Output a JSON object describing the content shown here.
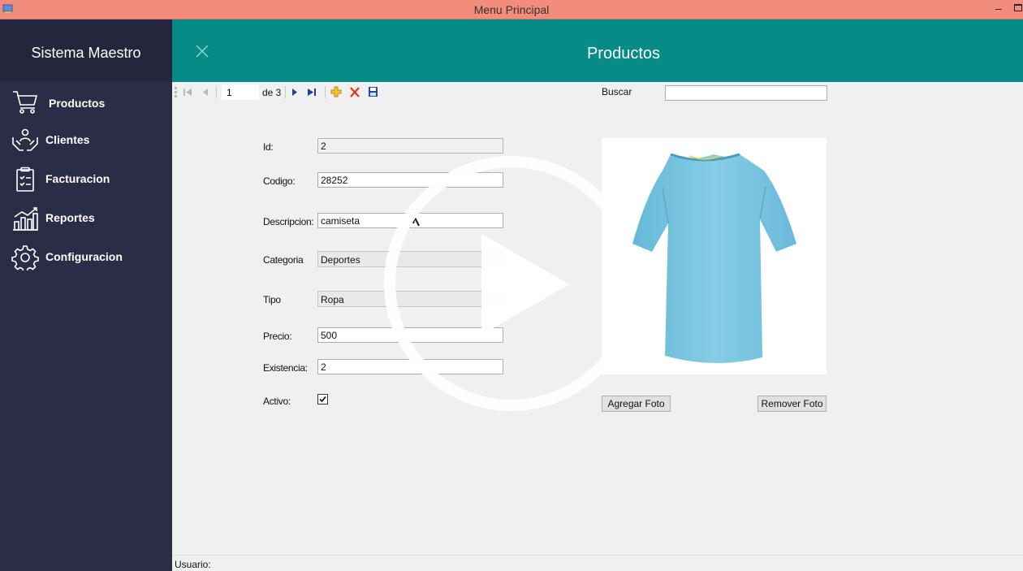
{
  "window": {
    "title": "Menu Principal",
    "minimize_glyph": "–"
  },
  "sidebar": {
    "title": "Sistema Maestro",
    "items": [
      {
        "label": "Productos",
        "icon": "cart-icon"
      },
      {
        "label": "Clientes",
        "icon": "hands-people-icon"
      },
      {
        "label": "Facturacion",
        "icon": "clipboard-check-icon"
      },
      {
        "label": "Reportes",
        "icon": "bar-chart-icon"
      },
      {
        "label": "Configuracion",
        "icon": "gear-icon"
      }
    ]
  },
  "header": {
    "title": "Productos"
  },
  "toolbar": {
    "position": "1",
    "of_label": "de 3"
  },
  "search": {
    "label": "Buscar",
    "value": ""
  },
  "form": {
    "id_label": "Id:",
    "id_value": "2",
    "code_label": "Codigo:",
    "code_value": "28252",
    "desc_label": "Descripcion:",
    "desc_value": "camiseta",
    "category_label": "Categoria",
    "category_value": "Deportes",
    "type_label": "Tipo",
    "type_value": "Ropa",
    "price_label": "Precio:",
    "price_value": "500",
    "stock_label": "Existencia:",
    "stock_value": "2",
    "active_label": "Activo:",
    "active_checked": true
  },
  "photo": {
    "add_label": "Agregar Foto",
    "remove_label": "Remover Foto"
  },
  "status": {
    "user_label": "Usuario:"
  },
  "colors": {
    "sidebar": "#2b2d47",
    "header": "#078b86",
    "titlebar": "#f28c7d",
    "shirt": "#7ec8e3"
  }
}
